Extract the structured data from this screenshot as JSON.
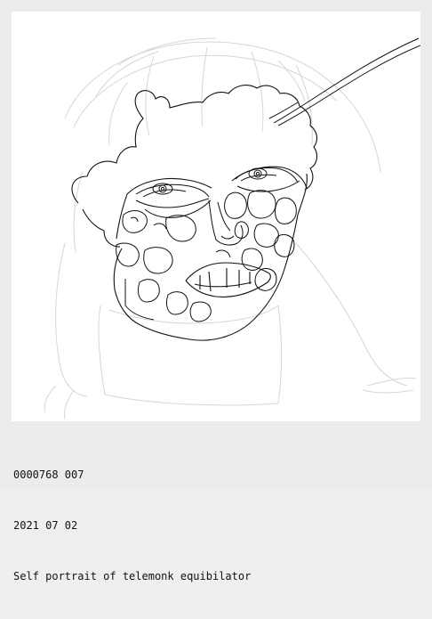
{
  "artwork": {
    "id_line": "0000768 007",
    "date_line": "2021 07 02",
    "title_line": "Self portrait of telemonk equibilator"
  },
  "colors": {
    "background": "#ececec",
    "paper": "#ffffff",
    "ink": "#111111",
    "faint_ink": "#d8d8d8"
  }
}
